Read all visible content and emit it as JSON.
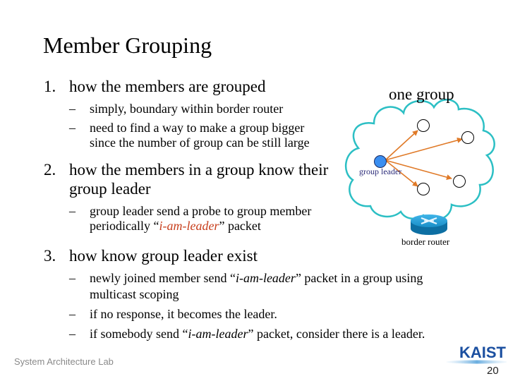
{
  "slide": {
    "title": "Member Grouping",
    "items": [
      {
        "number": "1.",
        "text": "how the members are grouped",
        "subitems": [
          {
            "dash": "–",
            "line1": "simply, boundary within border router"
          },
          {
            "dash": "–",
            "line1": "need to find a way to make a group bigger",
            "line2": "since the number of group can be still large"
          }
        ]
      },
      {
        "number": "2.",
        "line1": "how the members in a group know their",
        "line2": "group leader",
        "subitems": [
          {
            "dash": "–",
            "line1": "group leader send a probe to group member",
            "line2_pre": "periodically “",
            "line2_em": "i-am-leader",
            "line2_post": "” packet"
          }
        ]
      },
      {
        "number": "3.",
        "text": "how know group leader exist",
        "subitems": [
          {
            "dash": "–",
            "line1_pre": "newly joined member send “",
            "line1_em": "i-am-leader",
            "line1_post": "” packet in a group using",
            "line2": "multicast scoping"
          },
          {
            "dash": "–",
            "line1": "if no response, it becomes the leader."
          },
          {
            "dash": "–",
            "line1_pre": "if somebody send “",
            "line1_em": "i-am-leader",
            "line1_post": "” packet, consider there is a leader."
          }
        ]
      }
    ]
  },
  "diagram": {
    "title": "one group",
    "leader_label": "group leader",
    "router_label": "border router",
    "colors": {
      "cloud": "#2cbfc4",
      "arrow": "#e07a28",
      "leader_node": "#3a8ef0",
      "router": "#1a8fc8",
      "highlight_text": "#c8401e"
    },
    "member_count": 4,
    "router_icon": "router-icon"
  },
  "footer": {
    "lab": "System Architecture Lab",
    "logo": "KAIST",
    "page": "20"
  }
}
